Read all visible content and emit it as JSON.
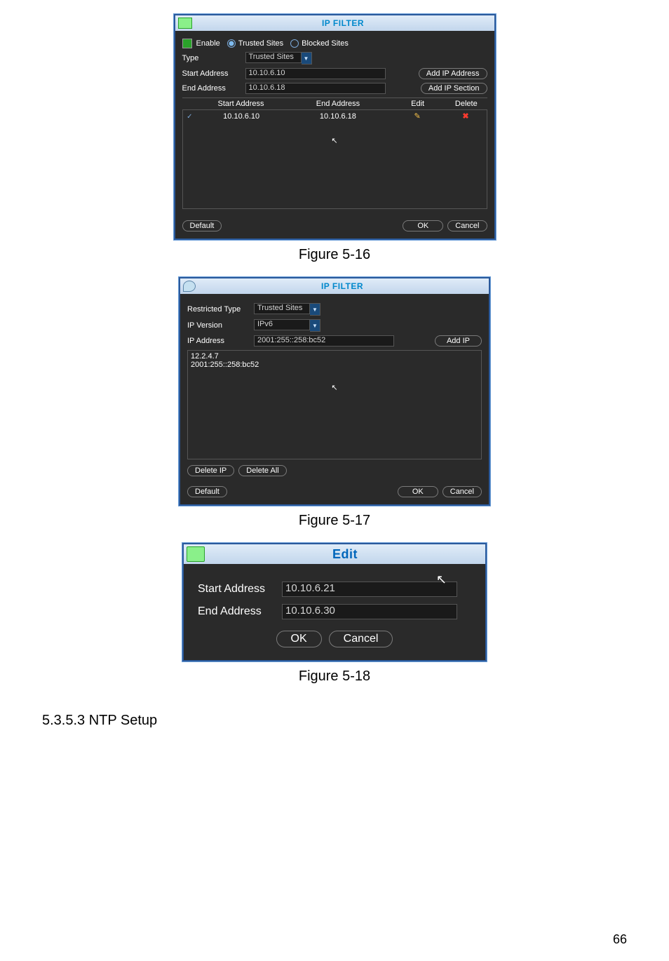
{
  "page_number": "66",
  "figure_caption_1": "Figure 5-16",
  "figure_caption_2": "Figure 5-17",
  "figure_caption_3": "Figure 5-18",
  "section_heading": "5.3.5.3  NTP Setup",
  "dialog1": {
    "title": "IP FILTER",
    "enable_label": "Enable",
    "radio_trusted": "Trusted Sites",
    "radio_blocked": "Blocked Sites",
    "type_label": "Type",
    "type_value": "Trusted Sites",
    "start_label": "Start Address",
    "start_value": "10.10.6.10",
    "end_label": "End Address",
    "end_value": "10.10.6.18",
    "add_addr_btn": "Add IP Address",
    "add_sect_btn": "Add IP Section",
    "cols": {
      "start": "Start Address",
      "end": "End Address",
      "edit": "Edit",
      "del": "Delete"
    },
    "rows": [
      {
        "start": "10.10.6.10",
        "end": "10.10.6.18"
      }
    ],
    "default_btn": "Default",
    "ok_btn": "OK",
    "cancel_btn": "Cancel"
  },
  "dialog2": {
    "title": "IP FILTER",
    "restricted_label": "Restricted Type",
    "restricted_value": "Trusted Sites",
    "ipver_label": "IP Version",
    "ipver_value": "IPv6",
    "ipaddr_label": "IP Address",
    "ipaddr_value": "2001:255::258:bc52",
    "addip_btn": "Add IP",
    "list_items": [
      "12.2.4.7",
      "2001:255::258:bc52"
    ],
    "delete_ip_btn": "Delete IP",
    "delete_all_btn": "Delete All",
    "default_btn": "Default",
    "ok_btn": "OK",
    "cancel_btn": "Cancel"
  },
  "dialog3": {
    "title": "Edit",
    "start_label": "Start Address",
    "start_value": "10.10.6.21",
    "end_label": "End Address",
    "end_value": "10.10.6.30",
    "ok_btn": "OK",
    "cancel_btn": "Cancel"
  }
}
